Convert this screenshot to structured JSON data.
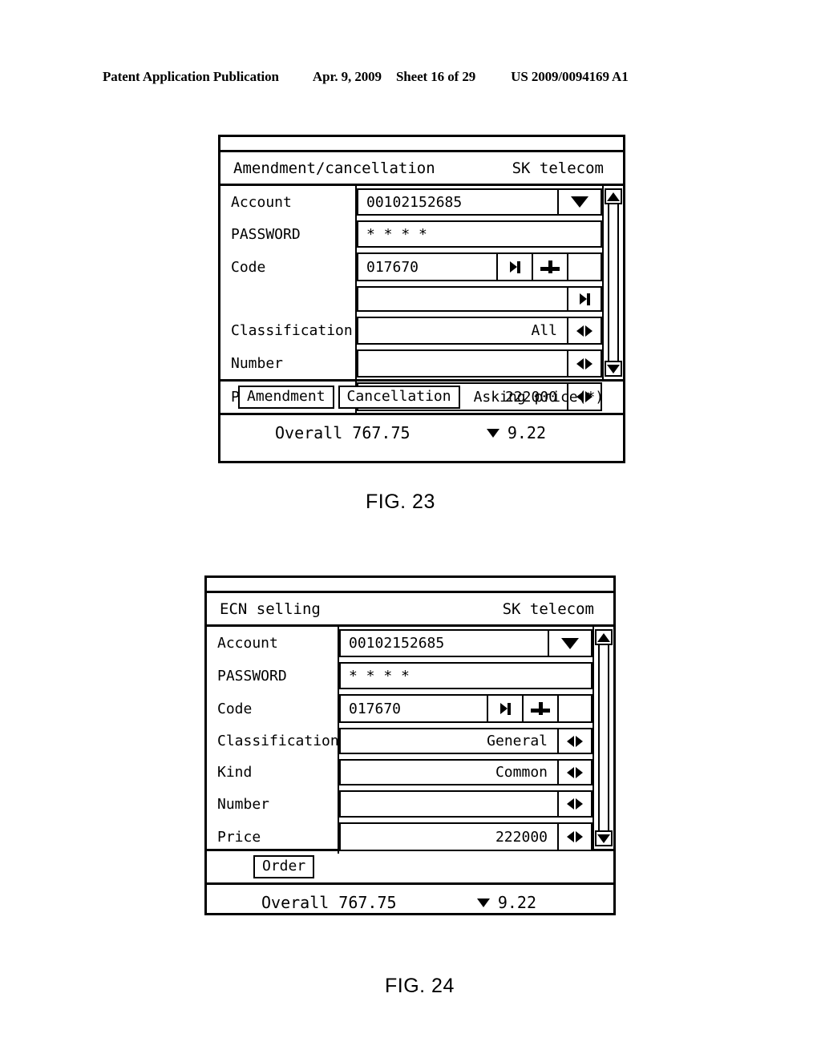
{
  "page_header": {
    "publication": "Patent Application Publication",
    "date": "Apr. 9, 2009",
    "sheet": "Sheet 16 of 29",
    "patent_number": "US 2009/0094169 A1"
  },
  "figures": [
    {
      "caption": "FIG. 23",
      "screen": {
        "title": "Amendment/cancellation",
        "carrier": "SK telecom",
        "rows": [
          {
            "label": "Account",
            "value": "00102152685",
            "control": "chevron-down"
          },
          {
            "label": "PASSWORD",
            "value": "* * * *",
            "control": "none"
          },
          {
            "label": "Code",
            "value": "017670",
            "control": "marker-plus"
          },
          {
            "label": "",
            "value": "",
            "control": "marker"
          },
          {
            "label": "Classification",
            "value": "All",
            "control": "left-right"
          },
          {
            "label": "Number",
            "value": "",
            "control": "left-right"
          },
          {
            "label": "Price",
            "value": "222000",
            "control": "left-right"
          }
        ],
        "buttons": [
          "Amendment",
          "Cancellation"
        ],
        "hint": "Asking price(*)",
        "status": {
          "overall_label": "Overall",
          "overall_value": "767.75",
          "change_value": "9.22",
          "change_direction": "down"
        }
      }
    },
    {
      "caption": "FIG. 24",
      "screen": {
        "title": "ECN selling",
        "carrier": "SK telecom",
        "rows": [
          {
            "label": "Account",
            "value": "00102152685",
            "control": "chevron-down"
          },
          {
            "label": "PASSWORD",
            "value": "* * * *",
            "control": "none"
          },
          {
            "label": "Code",
            "value": "017670",
            "control": "marker-plus"
          },
          {
            "label": "Classification",
            "value": "General",
            "control": "left-right"
          },
          {
            "label": "Kind",
            "value": "Common",
            "control": "left-right"
          },
          {
            "label": "Number",
            "value": "",
            "control": "left-right"
          },
          {
            "label": "Price",
            "value": "222000",
            "control": "left-right"
          }
        ],
        "buttons": [
          "Order"
        ],
        "hint": "",
        "status": {
          "overall_label": "Overall",
          "overall_value": "767.75",
          "change_value": "9.22",
          "change_direction": "down"
        }
      }
    }
  ]
}
